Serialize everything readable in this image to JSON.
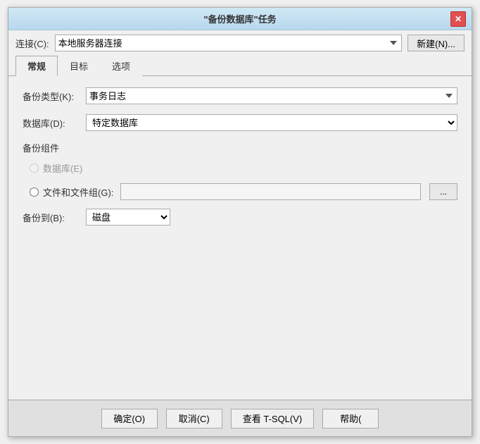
{
  "window": {
    "title": "\"备份数据库\"任务",
    "close_btn": "✕"
  },
  "toolbar": {
    "connection_label": "连接(C):",
    "connection_value": "本地服务器连接",
    "new_btn": "新建(N)..."
  },
  "tabs": [
    {
      "label": "常规",
      "active": true
    },
    {
      "label": "目标",
      "active": false
    },
    {
      "label": "选项",
      "active": false
    }
  ],
  "form": {
    "backup_type_label": "备份类型(K):",
    "backup_type_value": "事务日志",
    "database_label": "数据库(D):",
    "database_value": "特定数据库",
    "backup_component_label": "备份组件",
    "radio_db_label": "数据库(E)",
    "radio_file_label": "文件和文件组(G):",
    "backup_to_label": "备份到(B):",
    "backup_to_value": "磁盘"
  },
  "bottom_buttons": {
    "confirm": "确定(O)",
    "cancel": "取消(C)",
    "view_tsql": "查看 T-SQL(V)",
    "help": "帮助("
  }
}
